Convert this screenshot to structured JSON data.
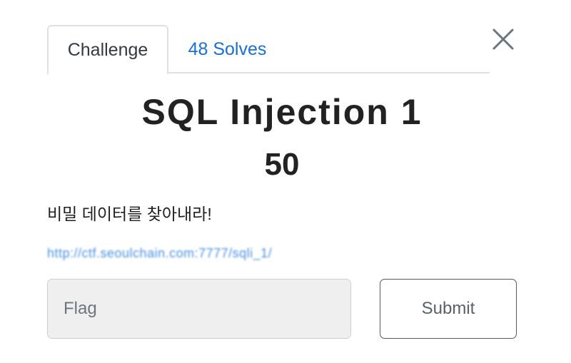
{
  "tabs": [
    {
      "label": "Challenge",
      "active": true
    },
    {
      "label": "48 Solves",
      "active": false
    }
  ],
  "challenge": {
    "name": "SQL Injection 1",
    "value": "50",
    "description": "비밀 데이터를 찾아내라!",
    "link_text": "http://ctf.seoulchain.com:7777/sqli_1/"
  },
  "form": {
    "flag_placeholder": "Flag",
    "flag_value": "",
    "submit_label": "Submit"
  },
  "icons": {
    "close": "close-icon"
  },
  "colors": {
    "link": "#1a6fd6",
    "input_bg": "#efefef",
    "border": "#dee2e6"
  }
}
